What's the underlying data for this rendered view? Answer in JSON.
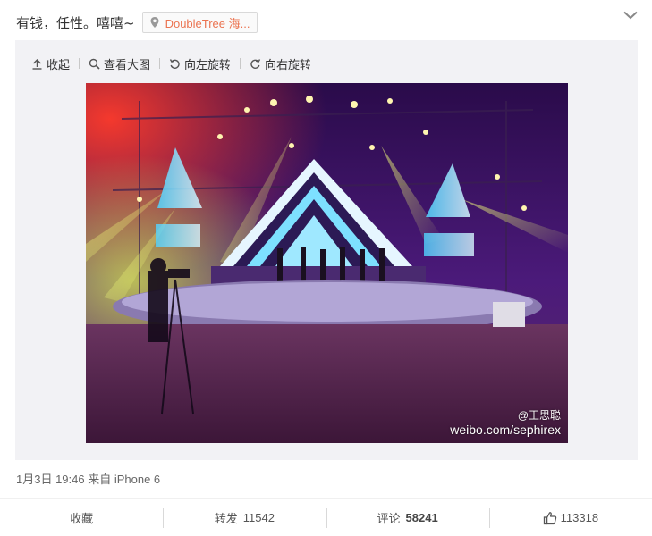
{
  "post": {
    "text": "有钱，任性。嘻嘻~",
    "location": "DoubleTree 海..."
  },
  "toolbar": {
    "collapse": "收起",
    "view_large": "查看大图",
    "rotate_left": "向左旋转",
    "rotate_right": "向右旋转"
  },
  "photo": {
    "watermark_handle": "@王思聪",
    "watermark_url": "weibo.com/sephirex"
  },
  "meta": {
    "timestamp": "1月3日 19:46",
    "source": "来自 iPhone 6"
  },
  "actions": {
    "favorite_label": "收藏",
    "repost_label": "转发",
    "repost_count": "11542",
    "comment_label": "评论",
    "comment_count": "58241",
    "like_count": "113318"
  },
  "colors": {
    "location_text": "#eb7350",
    "panel_bg": "#f2f2f5"
  }
}
